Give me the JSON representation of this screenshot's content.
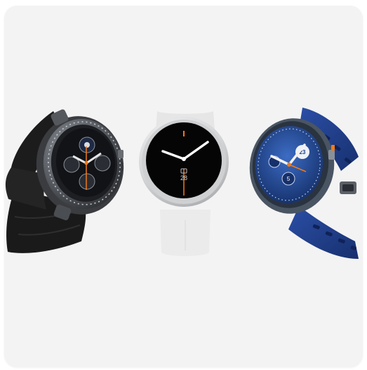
{
  "product_image": {
    "watches": [
      {
        "style": "classic-black",
        "strap_color": "#1c1c1c",
        "case_color": "#6a6d72",
        "dial_color": "#111317",
        "accent_color": "#f07a1a",
        "subdial_colors": [
          "#1f2a44",
          "#2a2d33",
          "#2a2d33"
        ]
      },
      {
        "style": "minimal-white",
        "strap_color": "#ebebeb",
        "case_color": "#d9dadb",
        "dial_color": "#050506",
        "accent_color": "#f07a1a",
        "dial_text": "28"
      },
      {
        "style": "sport-blue",
        "strap_color": "#1f3a85",
        "case_color": "#4a5563",
        "dial_color": "#1e3f82",
        "accent_color": "#f07a1a",
        "subdial_numbers": [
          "23",
          "5"
        ]
      }
    ]
  }
}
